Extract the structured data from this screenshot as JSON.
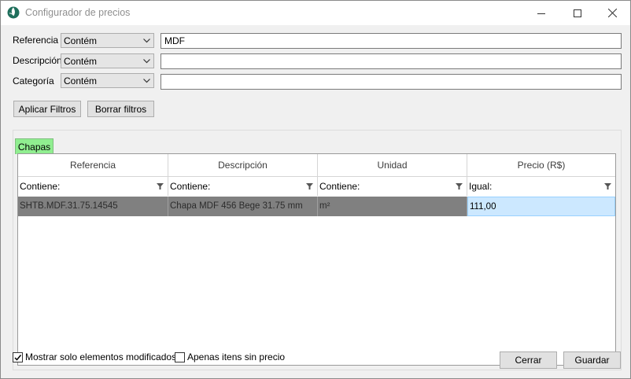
{
  "window": {
    "title": "Configurador de precios",
    "icon": "globe-leaf-icon",
    "controls": [
      "minimize-icon",
      "maximize-icon",
      "close-icon"
    ]
  },
  "filters": [
    {
      "label": "Referencia",
      "operator": "Contém",
      "value": "MDF"
    },
    {
      "label": "Descripción",
      "operator": "Contém",
      "value": ""
    },
    {
      "label": "Categoría",
      "operator": "Contém",
      "value": ""
    }
  ],
  "buttons": {
    "apply": "Aplicar Filtros",
    "clear": "Borrar filtros",
    "close": "Cerrar",
    "save": "Guardar"
  },
  "tabs": [
    {
      "label": "Chapas",
      "active": true,
      "color": "#90ee90"
    }
  ],
  "grid": {
    "columns": [
      "Referencia",
      "Descripción",
      "Unidad",
      "Precio (R$)"
    ],
    "filter_row": [
      "Contiene:",
      "Contiene:",
      "Contiene:",
      "Igual:"
    ],
    "rows": [
      [
        "SHTB.MDF.31.75.14545",
        "Chapa MDF 456 Bege 31.75 mm",
        "m²",
        "111,00"
      ]
    ]
  },
  "options": {
    "show_modified": {
      "label": "Mostrar solo elementos modificados",
      "checked": true
    },
    "no_price": {
      "label": "Apenas itens sin precio",
      "checked": false
    }
  },
  "colors": {
    "tab_active": "#90ee90",
    "row_readonly": "#808080",
    "cell_selected": "#cce8ff"
  }
}
